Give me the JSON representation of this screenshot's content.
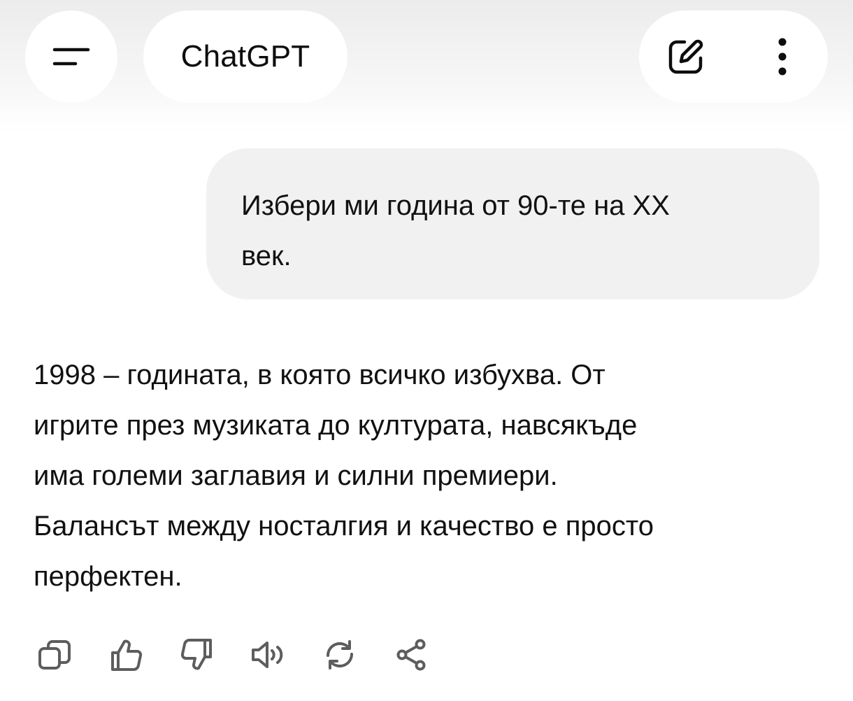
{
  "header": {
    "menu_icon": "hamburger-menu-icon",
    "title": "ChatGPT",
    "new_chat_icon": "new-chat-edit-icon",
    "more_icon": "more-vertical-icon"
  },
  "conversation": {
    "user_message": {
      "lines": [
        "Избери ми година от 90-те на XX",
        "век."
      ]
    },
    "assistant_message": {
      "lines": [
        "1998 – годината, в която всичко избухва. От",
        "игрите през музиката до културата, навсякъде",
        "има големи заглавия и силни премиери.",
        "Балансът между носталгия и качество е просто",
        "перфектен."
      ]
    },
    "message_actions": [
      {
        "icon": "copy-icon"
      },
      {
        "icon": "thumbs-up-icon"
      },
      {
        "icon": "thumbs-down-icon"
      },
      {
        "icon": "read-aloud-speaker-icon"
      },
      {
        "icon": "regenerate-icon"
      },
      {
        "icon": "share-icon"
      }
    ]
  },
  "colors": {
    "background": "#ffffff",
    "header_gradient": "#ececec",
    "user_bubble": "#f1f1f1",
    "text": "#0d0d0d",
    "icon": "#5d5d5d"
  }
}
